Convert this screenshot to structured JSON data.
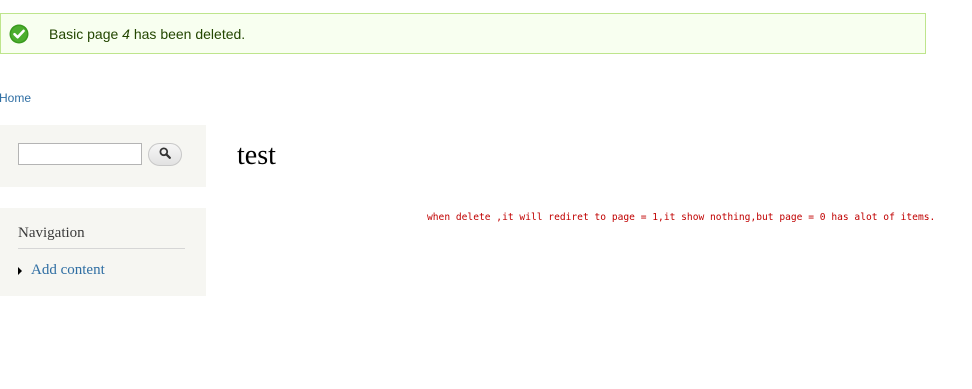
{
  "status": {
    "message_prefix": "Basic page ",
    "message_title": "4",
    "message_suffix": " has been deleted.",
    "color_border": "#bee58c",
    "color_background": "#f8fff0",
    "icon": "check-circle-icon"
  },
  "breadcrumb": {
    "home": "Home"
  },
  "search": {
    "value": "",
    "button_icon": "search-icon"
  },
  "navigation": {
    "title": "Navigation",
    "items": [
      {
        "label": "Add content"
      }
    ]
  },
  "main": {
    "title": "test",
    "note": "when delete ,it will rediret to page = 1,it show nothing,but page = 0 has alot of items."
  }
}
